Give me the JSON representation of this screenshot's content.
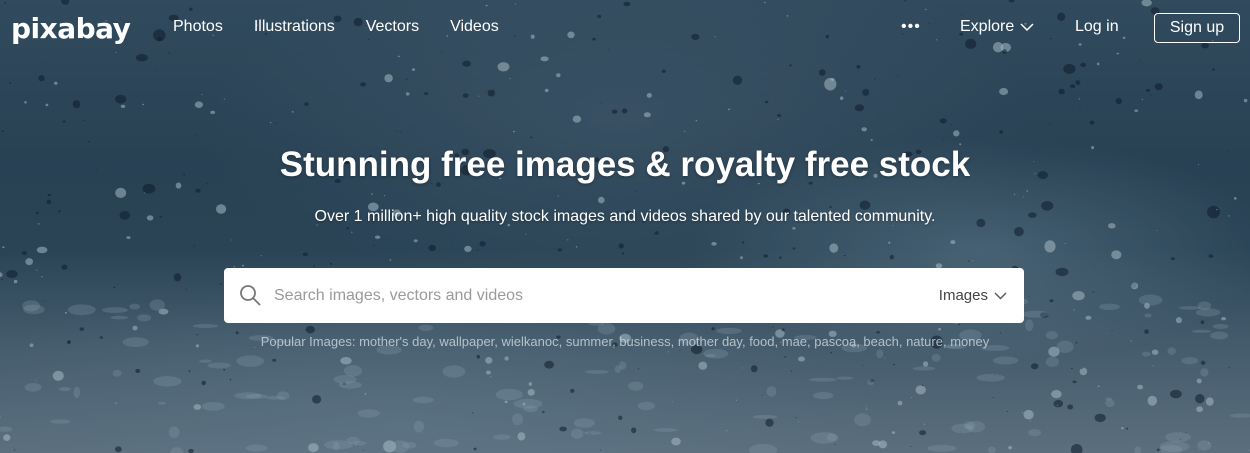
{
  "brand": {
    "logo_text": "pixabay"
  },
  "nav": {
    "links": [
      "Photos",
      "Illustrations",
      "Vectors",
      "Videos"
    ],
    "more_label": "•••",
    "explore_label": "Explore",
    "login_label": "Log in",
    "signup_label": "Sign up"
  },
  "hero": {
    "title": "Stunning free images & royalty free stock",
    "subtitle": "Over 1 million+ high quality stock images and videos shared by our talented community."
  },
  "search": {
    "placeholder": "Search images, vectors and videos",
    "value": "",
    "type_selected": "Images"
  },
  "popular": {
    "label": "Popular Images:",
    "terms": [
      "mother's day",
      "wallpaper",
      "wielkanoc",
      "summer",
      "business",
      "mother day",
      "food",
      "mae",
      "pascoa",
      "beach",
      "nature",
      "money"
    ]
  },
  "colors": {
    "hero_base": "#2f4a5e",
    "text_primary": "#ffffff",
    "popular_text": "#c8d2da"
  },
  "icons": {
    "search": "search-icon",
    "explore_chevron": "chevron-down-icon",
    "type_chevron": "chevron-down-icon",
    "more": "more-dots-icon"
  }
}
